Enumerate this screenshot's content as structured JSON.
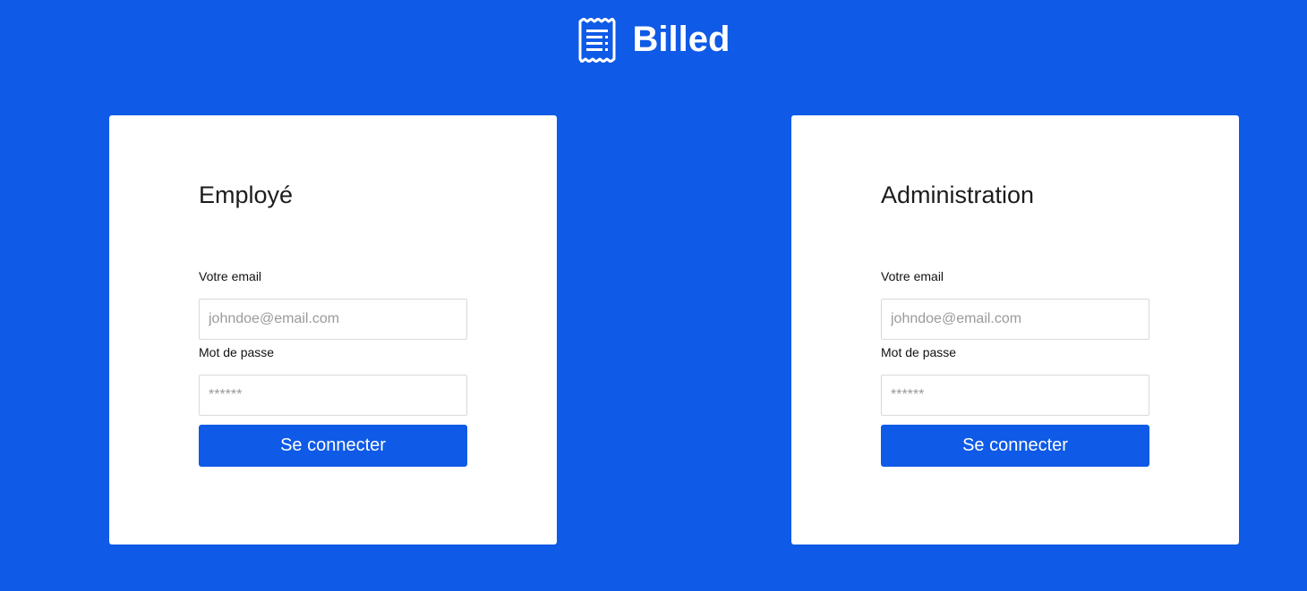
{
  "header": {
    "title": "Billed",
    "icon": "receipt-icon"
  },
  "colors": {
    "background": "#0f5ae6",
    "card": "#ffffff",
    "button": "#0f5ae6"
  },
  "employee_form": {
    "title": "Employé",
    "email_label": "Votre email",
    "email_placeholder": "johndoe@email.com",
    "email_value": "",
    "password_label": "Mot de passe",
    "password_placeholder": "******",
    "password_value": "",
    "submit_label": "Se connecter"
  },
  "admin_form": {
    "title": "Administration",
    "email_label": "Votre email",
    "email_placeholder": "johndoe@email.com",
    "email_value": "",
    "password_label": "Mot de passe",
    "password_placeholder": "******",
    "password_value": "",
    "submit_label": "Se connecter"
  }
}
